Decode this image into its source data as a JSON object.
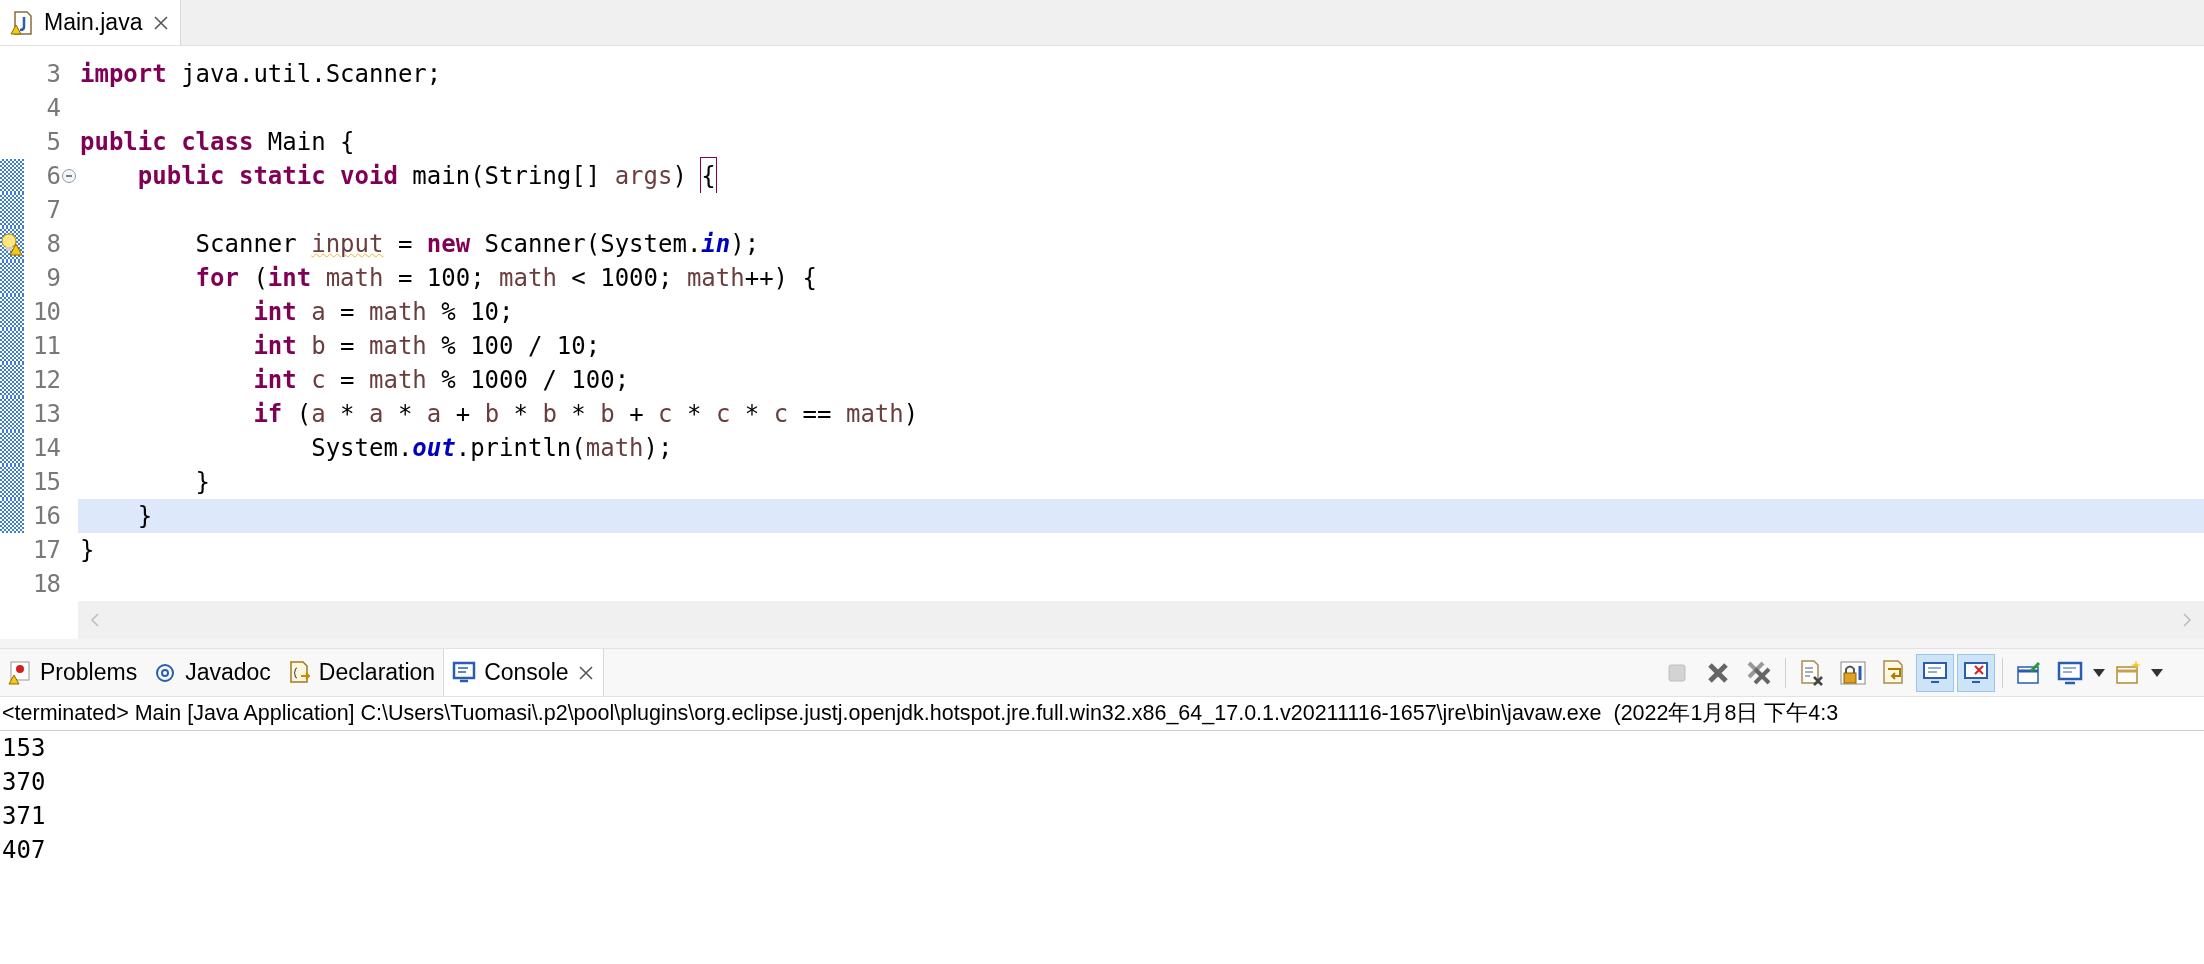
{
  "editor": {
    "tabs": [
      {
        "label": "Main.java",
        "selected": true
      }
    ],
    "lines": [
      {
        "number": "3",
        "changed": false,
        "current": false,
        "tokens": [
          {
            "text": "import",
            "kind": "keyword"
          },
          {
            "text": " java.util.Scanner;",
            "kind": "plain"
          }
        ]
      },
      {
        "number": "4",
        "changed": false,
        "current": false
      },
      {
        "number": "5",
        "changed": false,
        "current": false,
        "tokens": [
          {
            "text": "public class",
            "kind": "keyword"
          },
          {
            "text": " Main {",
            "kind": "plain"
          }
        ]
      },
      {
        "number": "6",
        "changed": true,
        "current": false,
        "collapsible": true,
        "tokens": [
          {
            "text": "    public static void",
            "kind": "keyword"
          },
          {
            "text": " main(String[] ",
            "kind": "plain"
          },
          {
            "text": "args",
            "kind": "local"
          },
          {
            "text": ") ",
            "kind": "plain"
          },
          {
            "text": "{",
            "kind": "bracket_match"
          }
        ]
      },
      {
        "number": "7",
        "changed": true,
        "current": false
      },
      {
        "number": "8",
        "changed": true,
        "current": false,
        "warning": true,
        "tokens": [
          {
            "text": "        Scanner ",
            "kind": "plain"
          },
          {
            "text": "input",
            "kind": "unused_local"
          },
          {
            "text": " = ",
            "kind": "plain"
          },
          {
            "text": "new",
            "kind": "keyword"
          },
          {
            "text": " Scanner(System.",
            "kind": "plain"
          },
          {
            "text": "in",
            "kind": "static_field"
          },
          {
            "text": ");",
            "kind": "plain"
          }
        ]
      },
      {
        "number": "9",
        "changed": true,
        "current": false,
        "tokens": [
          {
            "text": "        for",
            "kind": "keyword"
          },
          {
            "text": " (",
            "kind": "plain"
          },
          {
            "text": "int",
            "kind": "keyword"
          },
          {
            "text": " math",
            "kind": "local"
          },
          {
            "text": " = 100; ",
            "kind": "plain"
          },
          {
            "text": "math",
            "kind": "local"
          },
          {
            "text": " < 1000; ",
            "kind": "plain"
          },
          {
            "text": "math",
            "kind": "local"
          },
          {
            "text": "++) {",
            "kind": "plain"
          }
        ]
      },
      {
        "number": "10",
        "changed": true,
        "current": false,
        "tokens": [
          {
            "text": "            int",
            "kind": "keyword"
          },
          {
            "text": " a",
            "kind": "local"
          },
          {
            "text": " = ",
            "kind": "plain"
          },
          {
            "text": "math",
            "kind": "local"
          },
          {
            "text": " % 10;",
            "kind": "plain"
          }
        ]
      },
      {
        "number": "11",
        "changed": true,
        "current": false,
        "tokens": [
          {
            "text": "            int",
            "kind": "keyword"
          },
          {
            "text": " b",
            "kind": "local"
          },
          {
            "text": " = ",
            "kind": "plain"
          },
          {
            "text": "math",
            "kind": "local"
          },
          {
            "text": " % 100 / 10;",
            "kind": "plain"
          }
        ]
      },
      {
        "number": "12",
        "changed": true,
        "current": false,
        "tokens": [
          {
            "text": "            int",
            "kind": "keyword"
          },
          {
            "text": " c",
            "kind": "local"
          },
          {
            "text": " = ",
            "kind": "plain"
          },
          {
            "text": "math",
            "kind": "local"
          },
          {
            "text": " % 1000 / 100;",
            "kind": "plain"
          }
        ]
      },
      {
        "number": "13",
        "changed": true,
        "current": false,
        "tokens": [
          {
            "text": "            if",
            "kind": "keyword"
          },
          {
            "text": " (",
            "kind": "plain"
          },
          {
            "text": "a",
            "kind": "local"
          },
          {
            "text": " * ",
            "kind": "plain"
          },
          {
            "text": "a",
            "kind": "local"
          },
          {
            "text": " * ",
            "kind": "plain"
          },
          {
            "text": "a",
            "kind": "local"
          },
          {
            "text": " + ",
            "kind": "plain"
          },
          {
            "text": "b",
            "kind": "local"
          },
          {
            "text": " * ",
            "kind": "plain"
          },
          {
            "text": "b",
            "kind": "local"
          },
          {
            "text": " * ",
            "kind": "plain"
          },
          {
            "text": "b",
            "kind": "local"
          },
          {
            "text": " + ",
            "kind": "plain"
          },
          {
            "text": "c",
            "kind": "local"
          },
          {
            "text": " * ",
            "kind": "plain"
          },
          {
            "text": "c",
            "kind": "local"
          },
          {
            "text": " * ",
            "kind": "plain"
          },
          {
            "text": "c",
            "kind": "local"
          },
          {
            "text": " == ",
            "kind": "plain"
          },
          {
            "text": "math",
            "kind": "local"
          },
          {
            "text": ")",
            "kind": "plain"
          }
        ]
      },
      {
        "number": "14",
        "changed": true,
        "current": false,
        "tokens": [
          {
            "text": "                System.",
            "kind": "plain"
          },
          {
            "text": "out",
            "kind": "static_field"
          },
          {
            "text": ".println(",
            "kind": "plain"
          },
          {
            "text": "math",
            "kind": "local"
          },
          {
            "text": ");",
            "kind": "plain"
          }
        ]
      },
      {
        "number": "15",
        "changed": true,
        "current": false,
        "tokens": [
          {
            "text": "        }",
            "kind": "plain"
          }
        ]
      },
      {
        "number": "16",
        "changed": true,
        "current": true,
        "tokens": [
          {
            "text": "    }",
            "kind": "plain"
          }
        ]
      },
      {
        "number": "17",
        "changed": false,
        "current": false,
        "tokens": [
          {
            "text": "}",
            "kind": "plain"
          }
        ]
      },
      {
        "number": "18",
        "changed": false,
        "current": false
      }
    ]
  },
  "bottom_panel": {
    "tabs": [
      {
        "label": "Problems",
        "selected": false
      },
      {
        "label": "Javadoc",
        "selected": false
      },
      {
        "label": "Declaration",
        "selected": false
      },
      {
        "label": "Console",
        "selected": true
      }
    ],
    "toolbar": [
      {
        "kind": "stop",
        "disabled": true,
        "pressed": false
      },
      {
        "kind": "remove",
        "disabled": false,
        "pressed": false
      },
      {
        "kind": "remove_all",
        "disabled": false,
        "pressed": false
      },
      {
        "kind": "separator"
      },
      {
        "kind": "clear",
        "disabled": false,
        "pressed": false
      },
      {
        "kind": "scroll_lock",
        "disabled": false,
        "pressed": false
      },
      {
        "kind": "word_wrap",
        "disabled": false,
        "pressed": false
      },
      {
        "kind": "show_on_out",
        "disabled": false,
        "pressed": true
      },
      {
        "kind": "show_on_err",
        "disabled": false,
        "pressed": true
      },
      {
        "kind": "separator"
      },
      {
        "kind": "pin",
        "disabled": false,
        "pressed": false
      },
      {
        "kind": "display_console",
        "disabled": false,
        "pressed": false,
        "dropdown": true
      },
      {
        "kind": "new_console",
        "disabled": false,
        "pressed": false,
        "dropdown": true
      }
    ],
    "console": {
      "header": "<terminated> Main [Java Application] C:\\Users\\Tuomasi\\.p2\\pool\\plugins\\org.eclipse.justj.openjdk.hotspot.jre.full.win32.x86_64_17.0.1.v20211116-1657\\jre\\bin\\javaw.exe  (2022年1月8日 下午4:3",
      "output": [
        "153",
        "370",
        "371",
        "407"
      ]
    }
  }
}
